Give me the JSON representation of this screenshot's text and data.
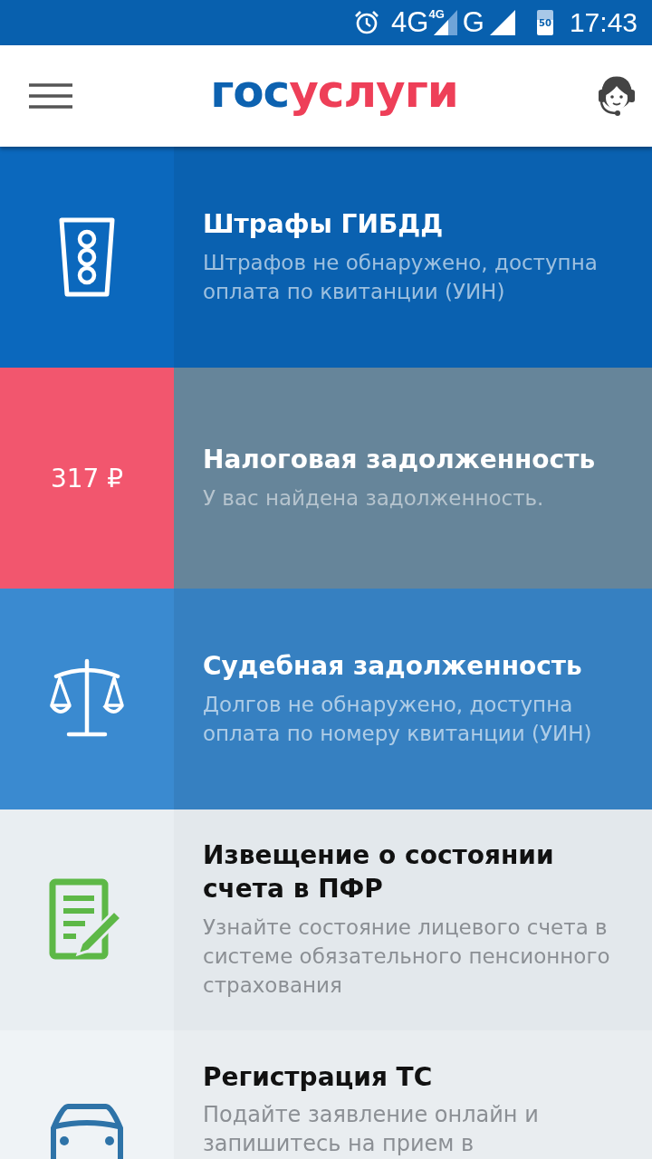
{
  "status_bar": {
    "network": "4G",
    "network_small": "4G",
    "network2": "G",
    "battery": "50",
    "time": "17:43"
  },
  "app_bar": {
    "logo_first": "гос",
    "logo_second": "услуги"
  },
  "services": [
    {
      "kind": "traffic-light",
      "color": "#0b68bd",
      "alert": false,
      "light": false,
      "title": "Штрафы ГИБДД",
      "description": "Штрафов не обнаружено, доступна оплата по квитанции (УИН)"
    },
    {
      "kind": "amount",
      "color": "#f2566e",
      "alert": true,
      "light": false,
      "amount": "317 ₽",
      "title": "Налоговая задолженность",
      "description": "У вас найдена задолженность."
    },
    {
      "kind": "scales",
      "color": "#3a8ad0",
      "alert": false,
      "light": false,
      "title": "Судебная задолженность",
      "description": "Долгов не обнаружено, доступна оплата по номеру квитанции (УИН)"
    },
    {
      "kind": "document",
      "color": "#e9eef2",
      "alert": false,
      "light": true,
      "title": "Извещение о состоянии счета в ПФР",
      "description": "Узнайте состояние лицевого счета в системе обязательного пенсионного страхования"
    },
    {
      "kind": "car",
      "color": "#eff3f6",
      "alert": false,
      "light": true,
      "title": "Регистрация ТС",
      "description": "Подайте заявление онлайн и запишитесь на прием в"
    }
  ]
}
